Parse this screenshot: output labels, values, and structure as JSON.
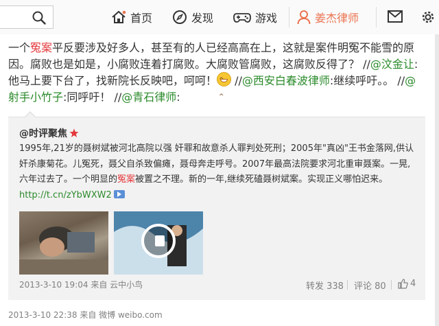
{
  "nav": {
    "home": "首页",
    "discover": "发现",
    "game": "游戏",
    "user": "姜杰律师"
  },
  "post": {
    "p1": "一个",
    "kw1": "冤案",
    "p2": "平反要涉及好多人，甚至有的人已经高高在上，这就是案件明冤不能雪的原因。腐败也是如是，小腐败连着打腐败。大腐败管腐败，这腐败反得了？ //",
    "mention1": "@汶金让",
    "p3": ":他马上要下台了，找新院长反映吧，呵呵！",
    "p4": " //",
    "mention2": "@西安白春波律师",
    "p5": ":继续呼吁。。 //",
    "mention3": "@射手小竹子",
    "p6": ":同呼吁！ //",
    "mention4": "@青石律师",
    "p7": ":"
  },
  "quote": {
    "author": "@时评聚焦",
    "t1": "1995年,21岁的聂树斌被河北高院以强 奸罪和故意杀人罪判处死刑；2005年\"真凶\"王书金落网,供认奸杀康菊花。儿冤死，聂父自杀致偏瘫，聂母奔走呼号。2007年最高法院要求河北重审聂案。一晃,六年过去了。一个明显的",
    "kw": "冤案",
    "t2": "被置之不理。新的一年,继续死磕聂树斌案。实现正义哪怕迟来。",
    "link": "http://t.cn/zYbWXW2",
    "time": "2013-3-10 19:04",
    "source": "来自 云中小鸟",
    "repost": "转发 338",
    "comment": "评论 80",
    "likes": "4"
  },
  "footer": {
    "meta": "2013-3-10 22:38 来自 微博 weibo.com"
  },
  "colors": {
    "accent": "#eb7350",
    "link": "#2a8a2a",
    "keyword": "#e4393c"
  }
}
